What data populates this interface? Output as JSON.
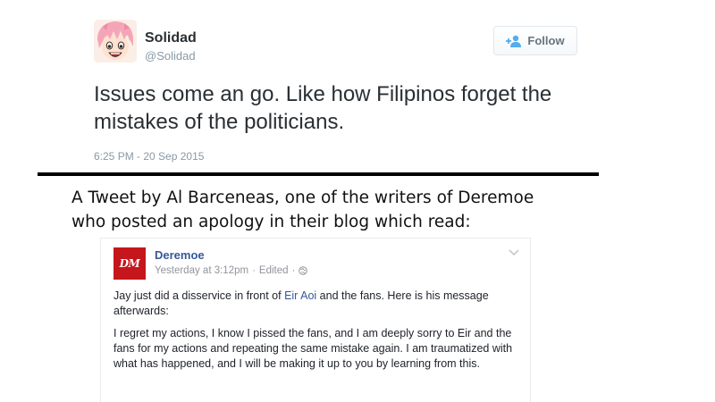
{
  "tweet": {
    "display_name": "Solidad",
    "handle": "@Solidad",
    "follow_label": "Follow",
    "text": "Issues come an go. Like how Filipinos forget the mistakes of the politicians.",
    "timestamp": "6:25 PM - 20 Sep 2015"
  },
  "caption": {
    "line1": "A Tweet by Al Barceneas, one of the writers of Deremoe",
    "line2": "who posted an apology in their blog which read:"
  },
  "fb_post": {
    "page_name": "Deremoe",
    "logo_text": "DM",
    "posted_time": "Yesterday at 3:12pm",
    "edited_label": "Edited",
    "separator": "·",
    "paragraph1_before": "Jay just did a disservice in front of ",
    "paragraph1_mention": "Eir Aoi",
    "paragraph1_after": " and the fans. Here is his message afterwards:",
    "paragraph2": "I regret my actions, I know I pissed the fans, and I am deeply sorry to Eir and the fans for my actions and repeating the same mistake again. I am traumatized with what has happened, and I will be making it up to you by learning from this."
  },
  "colors": {
    "link": "#365899",
    "muted": "#8899a6",
    "brand_red": "#c4161c"
  }
}
